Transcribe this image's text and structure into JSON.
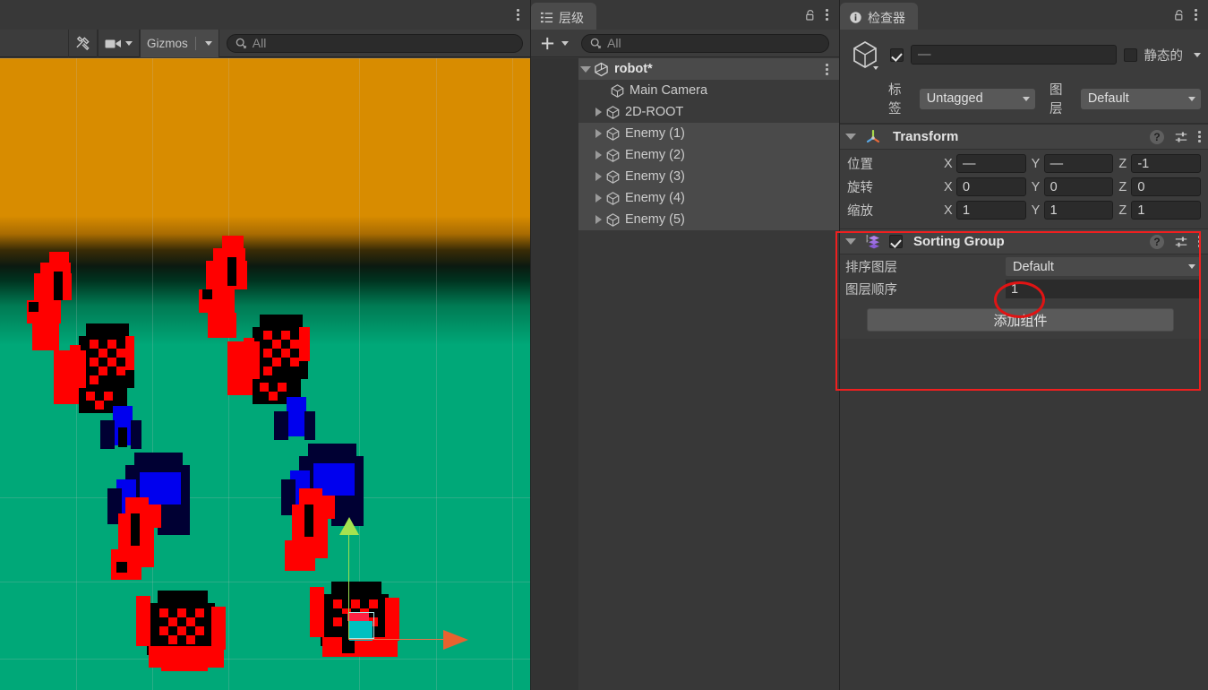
{
  "scene_view": {
    "tab_kebab": "kebab-menu",
    "toolbar": {
      "tools_icon": "tools-icon",
      "camera_icon": "camera-icon",
      "gizmos_label": "Gizmos",
      "search_placeholder": "All",
      "search_value": "",
      "search_icon": "search-icon"
    },
    "canvas": {
      "sky_color": "#d88c00",
      "ground_color": "#00a878",
      "gizmo_y_color": "#a5e24f",
      "gizmo_x_color": "#e8622f",
      "selection_outline_color": "#a9e8e8"
    }
  },
  "hierarchy": {
    "tab_label": "层级",
    "tab_icon": "hierarchy-icon",
    "lock_icon": "lock-icon",
    "kebab": "kebab-menu",
    "toolbar": {
      "add_label": "+",
      "search_placeholder": "All",
      "search_value": "",
      "search_icon": "search-icon"
    },
    "items": [
      {
        "label": "robot*",
        "icon": "unity-scene-icon",
        "indent": 0,
        "twisty": "open",
        "state": "scene",
        "kebab": "kebab-menu"
      },
      {
        "label": "Main Camera",
        "icon": "gameobject-cube-icon",
        "indent": 1,
        "twisty": "none",
        "state": "dim"
      },
      {
        "label": "2D-ROOT",
        "icon": "gameobject-cube-icon",
        "indent": 1,
        "twisty": "closed",
        "state": "dim"
      },
      {
        "label": "Enemy (1)",
        "icon": "gameobject-cube-icon",
        "indent": 1,
        "twisty": "closed",
        "state": "selected"
      },
      {
        "label": "Enemy (2)",
        "icon": "gameobject-cube-icon",
        "indent": 1,
        "twisty": "closed",
        "state": "selected"
      },
      {
        "label": "Enemy (3)",
        "icon": "gameobject-cube-icon",
        "indent": 1,
        "twisty": "closed",
        "state": "selected"
      },
      {
        "label": "Enemy (4)",
        "icon": "gameobject-cube-icon",
        "indent": 1,
        "twisty": "closed",
        "state": "selected"
      },
      {
        "label": "Enemy (5)",
        "icon": "gameobject-cube-icon",
        "indent": 1,
        "twisty": "closed",
        "state": "selected"
      }
    ]
  },
  "inspector": {
    "tab_label": "检查器",
    "tab_icon": "info-icon",
    "lock_icon": "lock-icon",
    "kebab": "kebab-menu",
    "object_header": {
      "prefab_icon": "prefab-cube-icon",
      "enabled": true,
      "name_value": "—",
      "static_checked": false,
      "static_label": "静态的",
      "tag_label": "标签",
      "tag_value": "Untagged",
      "layer_label": "图层",
      "layer_value": "Default"
    },
    "components": [
      {
        "name": "Transform",
        "icon": "transform-axis-icon",
        "expanded": true,
        "has_enable_checkbox": false,
        "help_icon": "help-icon",
        "preset_icon": "preset-settings-icon",
        "kebab": "kebab-menu",
        "rows": [
          {
            "label": "位置",
            "type": "vector3",
            "axes": [
              "X",
              "Y",
              "Z"
            ],
            "values": [
              "—",
              "—",
              "-1"
            ]
          },
          {
            "label": "旋转",
            "type": "vector3",
            "axes": [
              "X",
              "Y",
              "Z"
            ],
            "values": [
              "0",
              "0",
              "0"
            ]
          },
          {
            "label": "缩放",
            "type": "vector3",
            "axes": [
              "X",
              "Y",
              "Z"
            ],
            "values": [
              "1",
              "1",
              "1"
            ]
          }
        ]
      },
      {
        "name": "Sorting Group",
        "icon": "sorting-group-icon",
        "expanded": true,
        "has_enable_checkbox": true,
        "enabled": true,
        "help_icon": "help-icon",
        "preset_icon": "preset-settings-icon",
        "kebab": "kebab-menu",
        "rows": [
          {
            "label": "排序图层",
            "type": "dropdown",
            "value": "Default"
          },
          {
            "label": "图层顺序",
            "type": "number",
            "value": "1"
          }
        ]
      }
    ],
    "add_component_label": "添加组件"
  },
  "annotations": {
    "rect_color": "#f01f1f",
    "ellipse_color": "#e01414"
  }
}
